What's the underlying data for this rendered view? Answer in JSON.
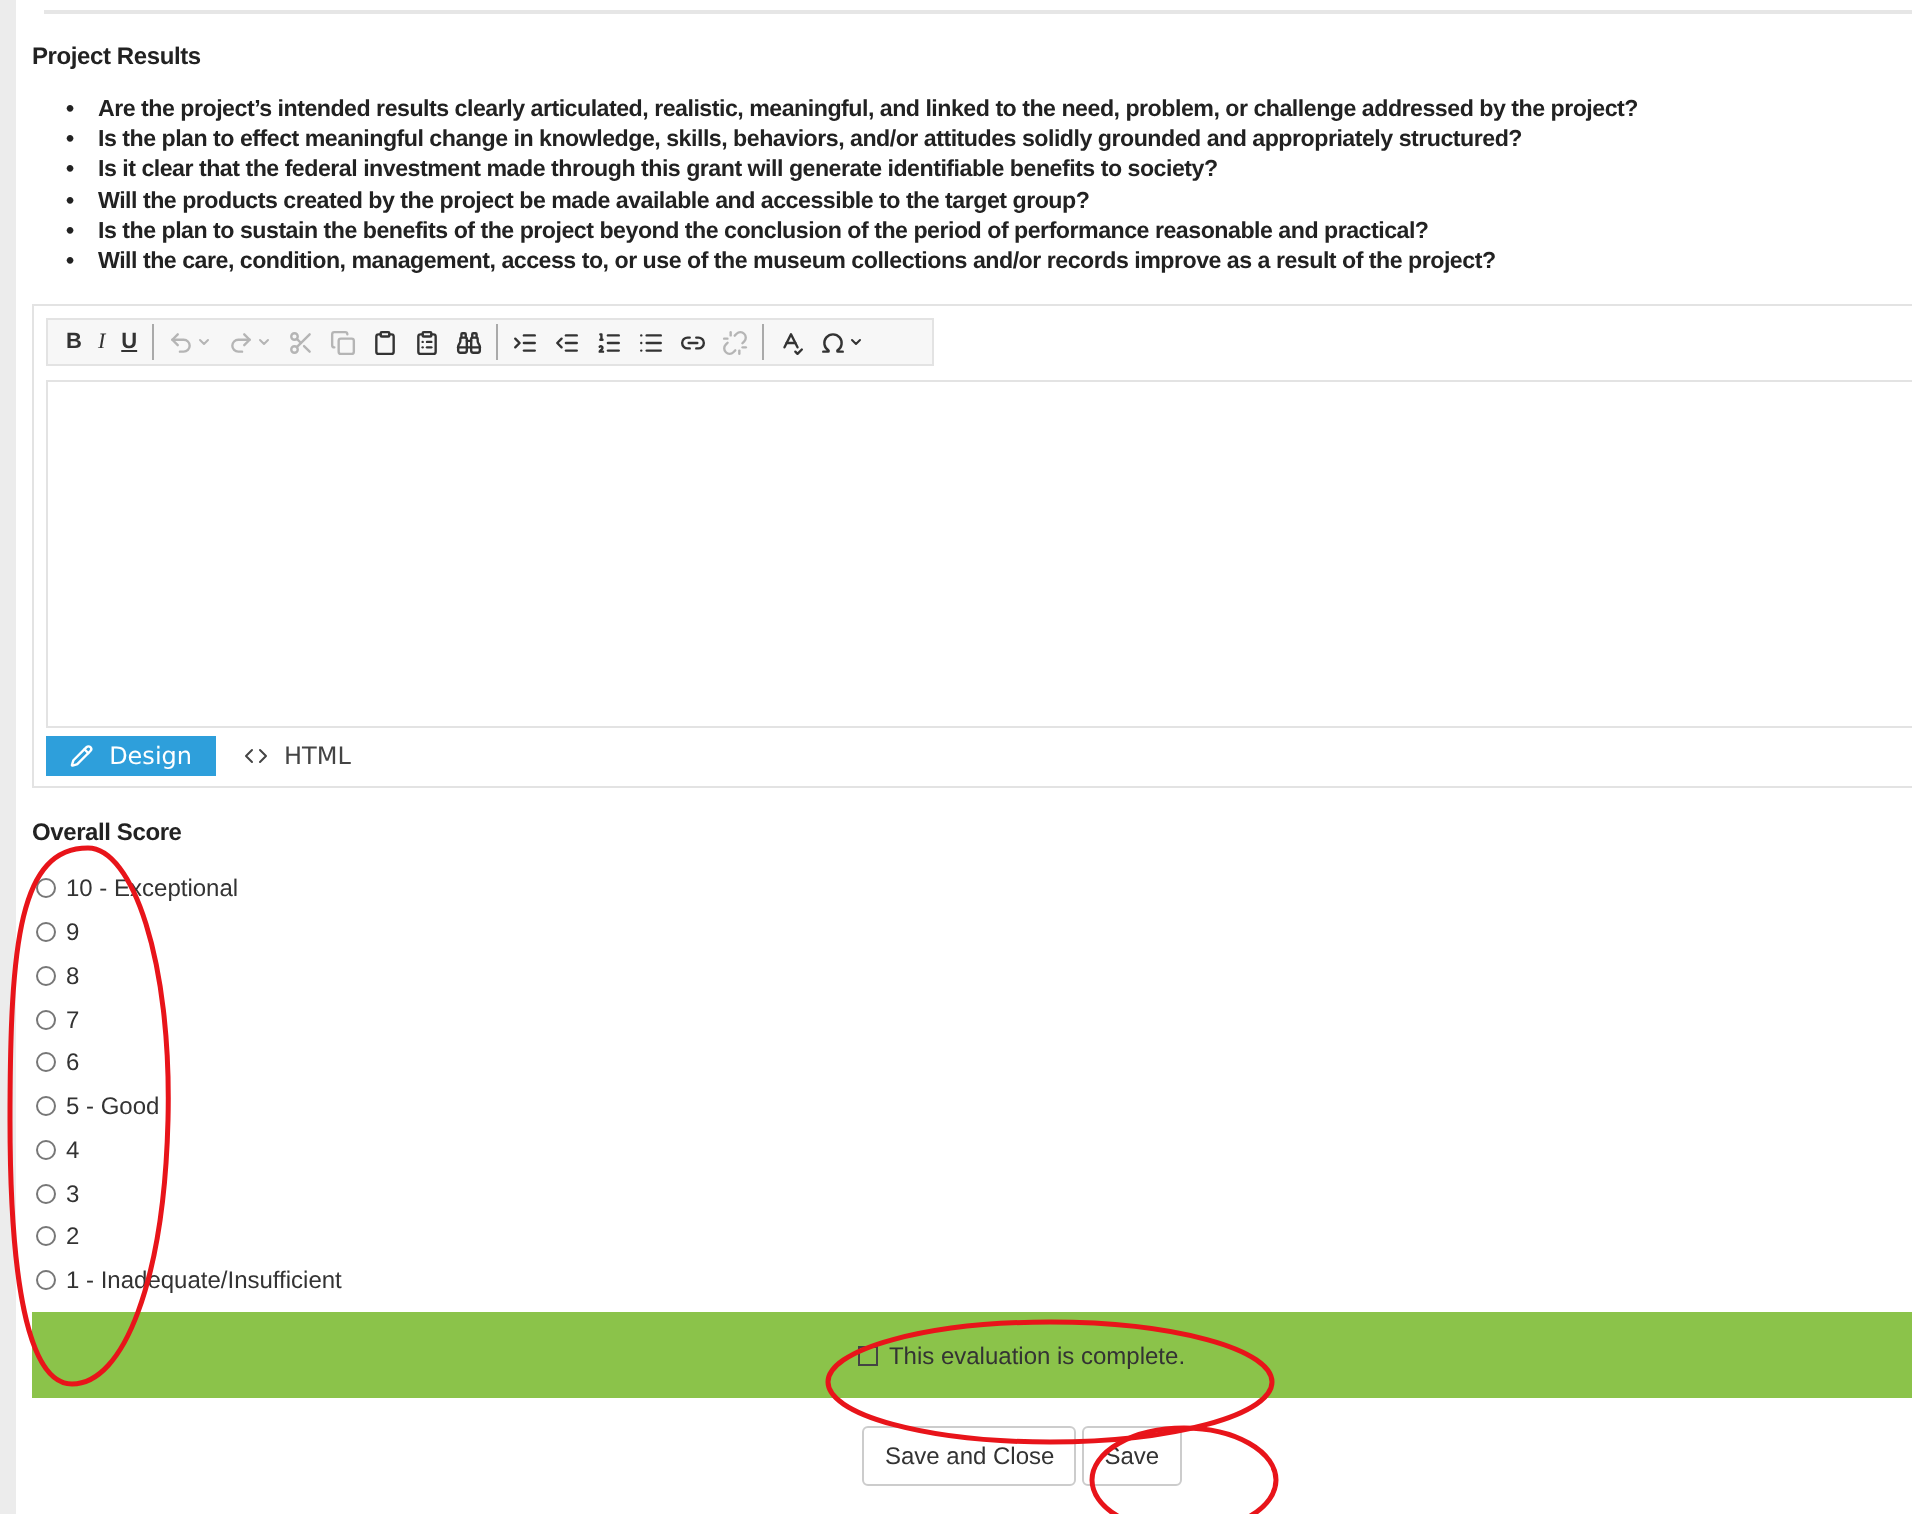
{
  "section_title": "Project Results",
  "questions": [
    {
      "marker": "•",
      "text": "Are the project’s intended results clearly articulated, realistic, meaningful, and linked to the need, problem, or challenge addressed by the project?"
    },
    {
      "marker": "•",
      "text": "Is the plan to effect meaningful change in knowledge, skills, behaviors, and/or attitudes solidly grounded and appropriately structured?"
    },
    {
      "marker": "•",
      "text": "Is it clear that the federal investment made through this grant will generate identifiable benefits to society?"
    },
    {
      "marker": "•",
      "text": "Will the products created by the project be made available and accessible to the target group?"
    },
    {
      "marker": "•",
      "text": "Is the plan to sustain the benefits of the project beyond the conclusion of the period of performance reasonable and practical?"
    },
    {
      "marker": "•",
      "text": "Will the care, condition, management, access to, or use of the museum collections and/or records improve as a result of the project?"
    }
  ],
  "editor": {
    "toolbar": [
      {
        "kind": "bold",
        "label": "B",
        "disabled": false
      },
      {
        "kind": "italic",
        "label": "I",
        "disabled": false
      },
      {
        "kind": "underline",
        "label": "U",
        "disabled": false
      },
      {
        "kind": "separator"
      },
      {
        "kind": "undo",
        "disabled": true
      },
      {
        "kind": "redo",
        "disabled": true
      },
      {
        "kind": "cut",
        "disabled": true
      },
      {
        "kind": "copy",
        "disabled": true
      },
      {
        "kind": "paste",
        "disabled": false
      },
      {
        "kind": "paste-text",
        "disabled": false
      },
      {
        "kind": "find",
        "disabled": false
      },
      {
        "kind": "separator"
      },
      {
        "kind": "indent",
        "disabled": false
      },
      {
        "kind": "outdent",
        "disabled": false
      },
      {
        "kind": "numbered-list",
        "disabled": false
      },
      {
        "kind": "bullet-list",
        "disabled": false
      },
      {
        "kind": "link",
        "disabled": false
      },
      {
        "kind": "unlink",
        "disabled": true
      },
      {
        "kind": "separator"
      },
      {
        "kind": "spellcheck",
        "disabled": false
      },
      {
        "kind": "symbol",
        "disabled": false
      }
    ],
    "modes": [
      {
        "label": "Design",
        "selected": true
      },
      {
        "label": "HTML",
        "selected": false
      }
    ]
  },
  "score": {
    "label": "Overall Score",
    "options": [
      {
        "label": "10 - Exceptional",
        "selected": false
      },
      {
        "label": "9",
        "selected": false
      },
      {
        "label": "8",
        "selected": false
      },
      {
        "label": "7",
        "selected": false
      },
      {
        "label": "6",
        "selected": false
      },
      {
        "label": "5 - Good",
        "selected": false
      },
      {
        "label": "4",
        "selected": false
      },
      {
        "label": "3",
        "selected": false
      },
      {
        "label": "2",
        "selected": false
      },
      {
        "label": "1 - Inadequate/Insufficient",
        "selected": false
      }
    ]
  },
  "completion": {
    "label": "This evaluation is complete.",
    "checked": false
  },
  "buttons": [
    "Save and Close",
    "Save"
  ],
  "annotations": [
    {
      "kind": "ellipse"
    },
    {
      "kind": "ellipse"
    },
    {
      "kind": "ellipse"
    }
  ]
}
